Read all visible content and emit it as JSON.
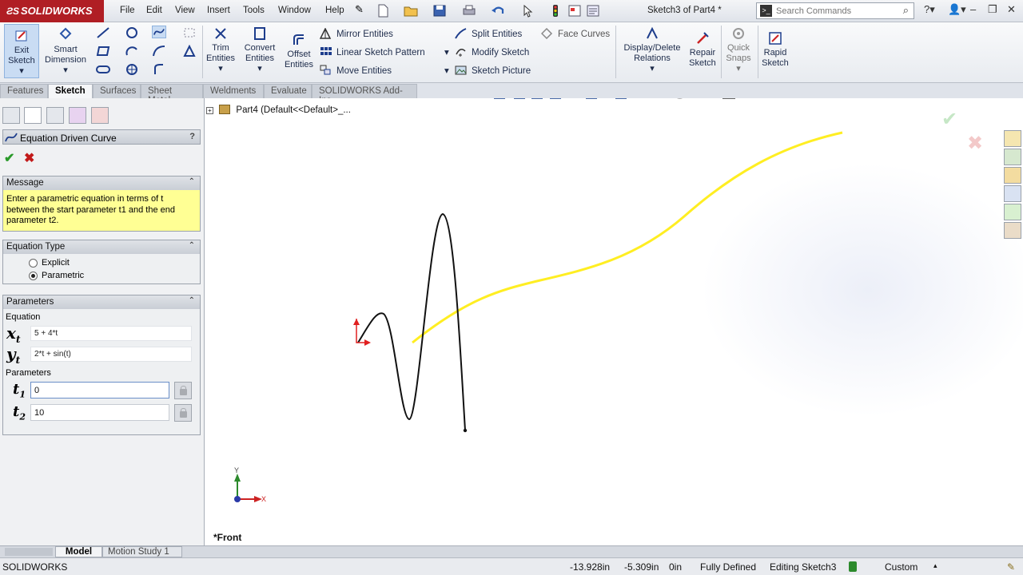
{
  "app": {
    "brand": "SOLIDWORKS",
    "document_title": "Sketch3 of Part4 *"
  },
  "menu": [
    "File",
    "Edit",
    "View",
    "Insert",
    "Tools",
    "Window",
    "Help"
  ],
  "search": {
    "placeholder": "Search Commands"
  },
  "commands": {
    "exit_sketch": [
      "Exit",
      "Sketch"
    ],
    "smart_dimension": [
      "Smart",
      "Dimension"
    ],
    "trim_entities": [
      "Trim",
      "Entities"
    ],
    "convert_entities": [
      "Convert",
      "Entities"
    ],
    "offset_entities": [
      "Offset",
      "Entities"
    ],
    "mirror_entities": "Mirror Entities",
    "linear_sketch_pattern": "Linear Sketch Pattern",
    "move_entities": "Move Entities",
    "split_entities": "Split Entities",
    "modify_sketch": "Modify Sketch",
    "sketch_picture": "Sketch Picture",
    "face_curves": "Face Curves",
    "display_delete_relations": [
      "Display/Delete",
      "Relations"
    ],
    "repair_sketch": [
      "Repair",
      "Sketch"
    ],
    "quick_snaps": [
      "Quick",
      "Snaps"
    ],
    "rapid_sketch": [
      "Rapid",
      "Sketch"
    ]
  },
  "tabs": [
    "Features",
    "Sketch",
    "Surfaces",
    "Sheet Metal",
    "Weldments",
    "Evaluate",
    "SOLIDWORKS Add-Ins"
  ],
  "active_tab": "Sketch",
  "property_manager": {
    "title": "Equation Driven Curve",
    "help": "?",
    "message_header": "Message",
    "message": "Enter a parametric equation in terms of t between the start parameter t1 and the end parameter t2.",
    "equation_type_header": "Equation Type",
    "equation_type_options": [
      "Explicit",
      "Parametric"
    ],
    "equation_type_selected": "Parametric",
    "parameters_header": "Parameters",
    "equation_label": "Equation",
    "x_symbol": "x",
    "y_symbol": "y",
    "t_symbol": "t",
    "xt_value": "5 + 4*t",
    "yt_value": "2*t + sin(t)",
    "parameters_label": "Parameters",
    "t1_value": "0",
    "t2_value": "10"
  },
  "graphics": {
    "tree_root": "Part4  (Default<<Default>_...",
    "view_name": "*Front",
    "axis_y": "Y",
    "axis_x": "X"
  },
  "bottom_tabs": [
    "Model",
    "Motion Study 1"
  ],
  "status": {
    "app": "SOLIDWORKS",
    "x": "-13.928in",
    "y": "-5.309in",
    "z": "0in",
    "state": "Fully Defined",
    "editing": "Editing Sketch3",
    "units": "Custom"
  },
  "colors": {
    "brand_red": "#b01e24",
    "curve_yellow": "#ffee22",
    "message_bg": "#ffff94"
  }
}
